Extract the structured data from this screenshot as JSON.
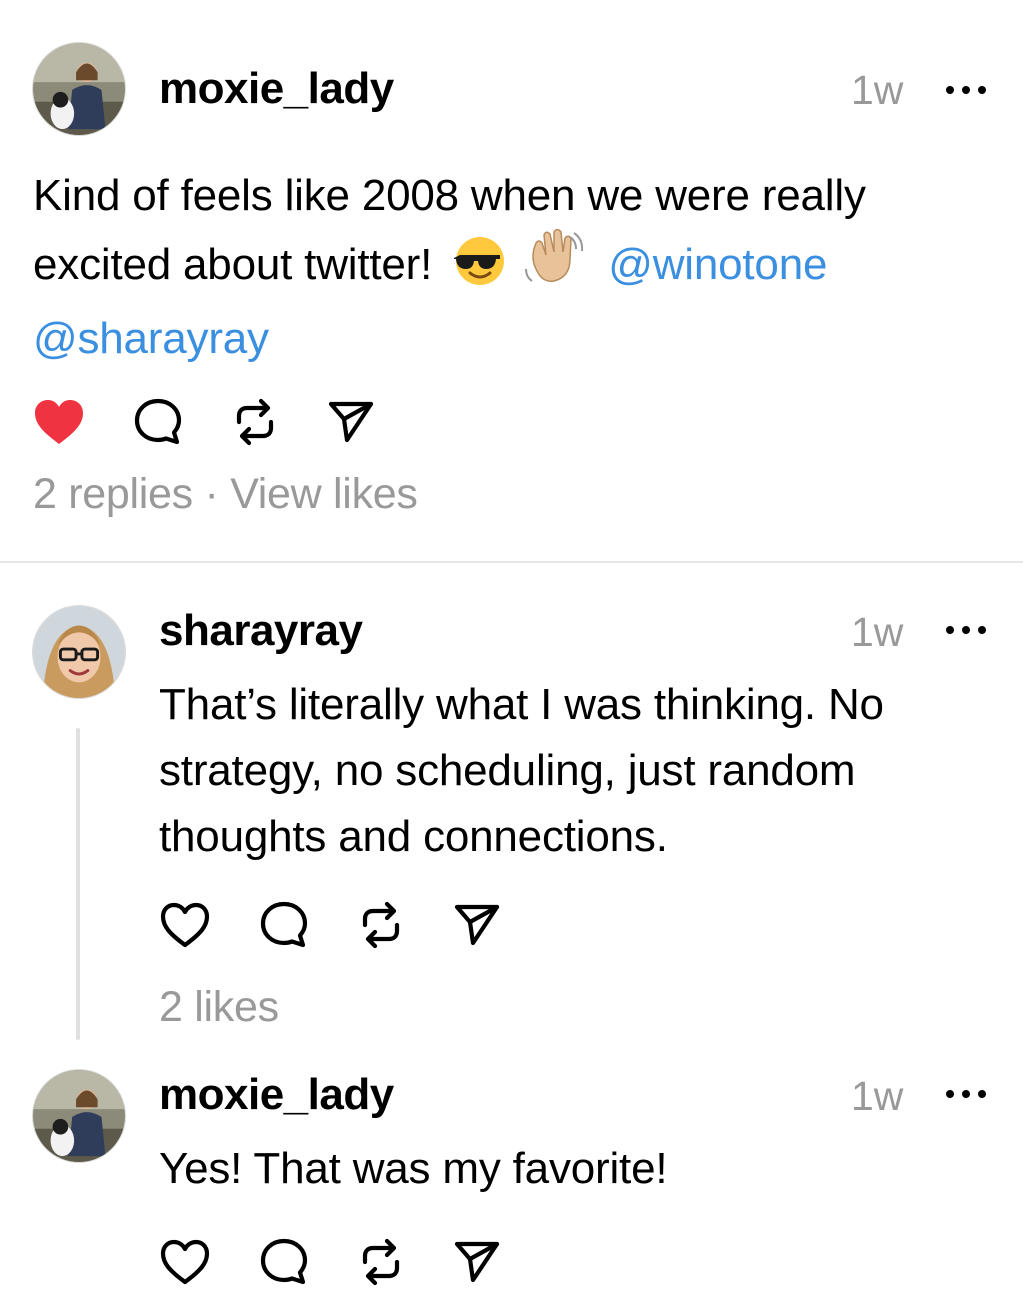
{
  "main_post": {
    "username": "moxie_lady",
    "timestamp": "1w",
    "text_line1": "Kind of feels like 2008 when we were really",
    "text_line2": "excited about twitter!",
    "emoji_1": "sunglasses-face",
    "emoji_2": "waving-hand",
    "mention_1": "@winotone",
    "mention_2": "@sharayray",
    "liked": true,
    "replies": "2 replies",
    "separator": "·",
    "view_likes": "View likes"
  },
  "reply_1": {
    "username": "sharayray",
    "timestamp": "1w",
    "text_line1": "That’s literally what I was thinking. No",
    "text_line2": "strategy, no scheduling, just random",
    "text_line3": "thoughts and connections.",
    "liked": false,
    "likes": "2 likes"
  },
  "reply_2": {
    "username": "moxie_lady",
    "timestamp": "1w",
    "text": "Yes! That was my favorite!",
    "liked": false
  },
  "colors": {
    "link": "#3b8fe0",
    "like_active": "#ef3340",
    "muted_text": "#999999"
  },
  "icons": [
    "heart-icon",
    "comment-icon",
    "repost-icon",
    "share-icon",
    "more-icon"
  ]
}
